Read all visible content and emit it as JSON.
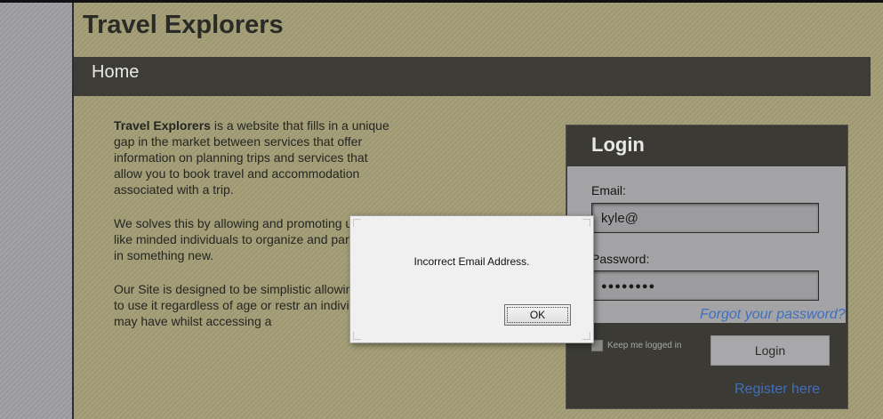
{
  "site": {
    "title": "Travel Explorers"
  },
  "nav": {
    "home": "Home"
  },
  "intro": {
    "p1_bold": "Travel Explorers",
    "p1_rest": " is a website that fills in a unique gap in the market between services that offer information on planning trips and services that allow you to book travel and accommodation associated with a trip.",
    "p2": "We solves this by allowing and promoting u to meet like minded individuals to organize and participate in something new.",
    "p3": "Our Site is designed to be simplistic allowin anyone to use it regardless of age or restr an individual may have whilst accessing a"
  },
  "login": {
    "title": "Login",
    "email_label": "Email:",
    "email_value": "kyle@",
    "password_label": "Password:",
    "password_value": "●●●●●●●●",
    "forgot": "Forgot your password?",
    "keep_logged_in": "Keep me logged in",
    "button": "Login",
    "register": "Register here"
  },
  "dialog": {
    "message": "Incorrect Email Address.",
    "ok": "OK"
  }
}
